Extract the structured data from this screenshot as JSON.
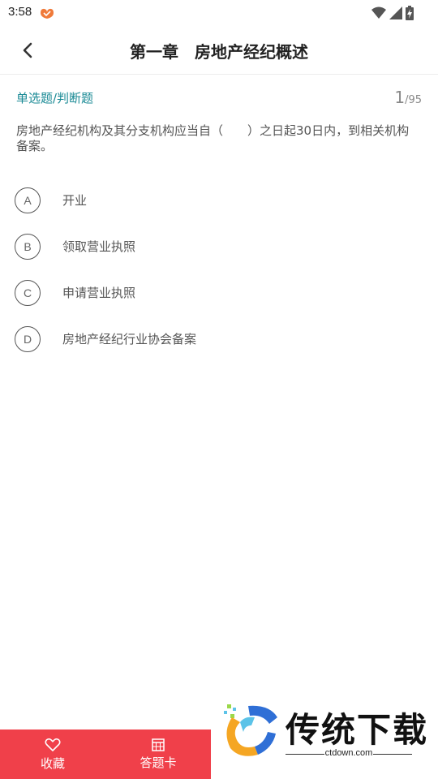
{
  "status_bar": {
    "time": "3:58"
  },
  "header": {
    "title": "第一章　房地产经纪概述"
  },
  "question": {
    "type_label": "单选题/判断题",
    "current": "1",
    "total": "/95",
    "text": "房地产经纪机构及其分支机构应当自（　　）之日起30日内，到相关机构备案。",
    "options": [
      {
        "letter": "A",
        "text": "开业"
      },
      {
        "letter": "B",
        "text": "领取营业执照"
      },
      {
        "letter": "C",
        "text": "申请营业执照"
      },
      {
        "letter": "D",
        "text": "房地产经纪行业协会备案"
      }
    ]
  },
  "bottom_bar": {
    "favorite_label": "收藏",
    "answer_card_label": "答题卡"
  },
  "watermark": {
    "brand": "传统下载",
    "domain": "ctdown.com"
  },
  "colors": {
    "accent_teal": "#1a8a95",
    "bottom_bar_red": "#f0404a"
  }
}
